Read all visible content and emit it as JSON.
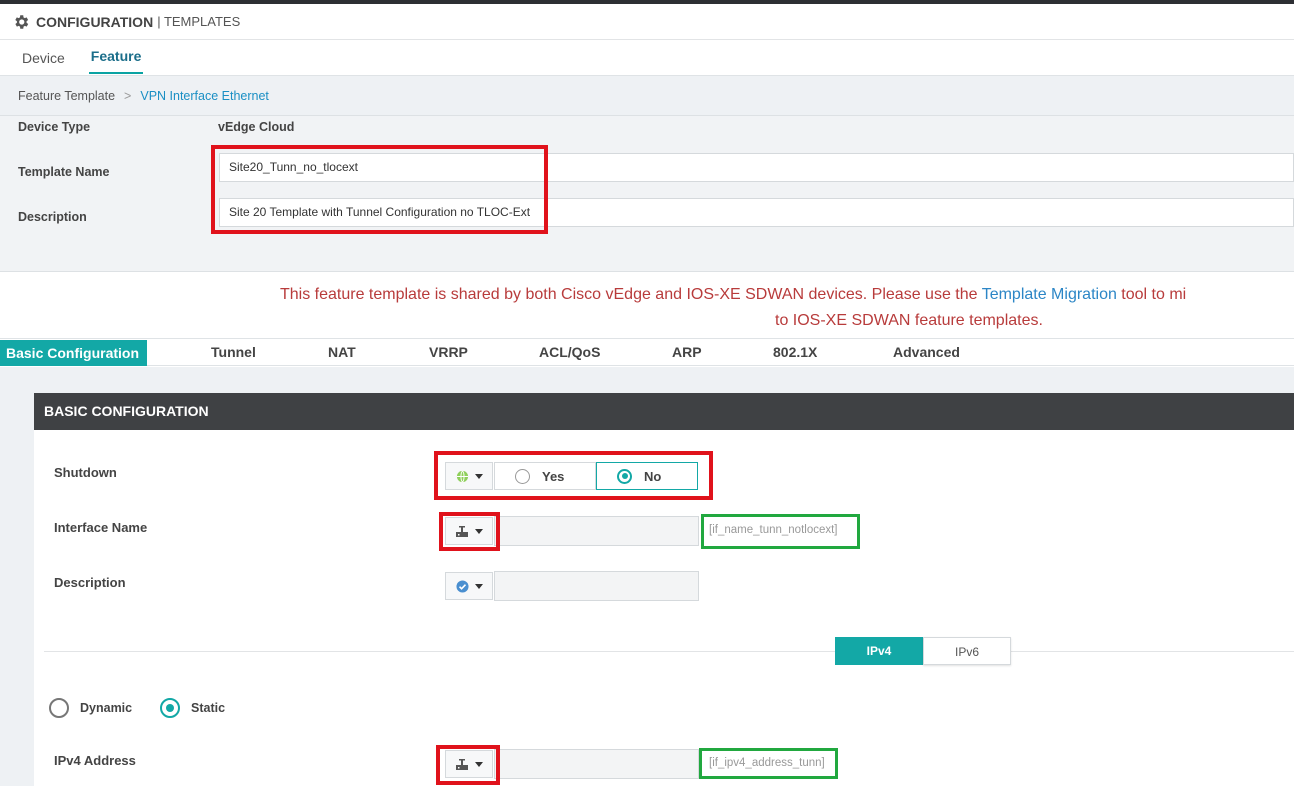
{
  "header": {
    "title": "CONFIGURATION",
    "subtitle": "| TEMPLATES",
    "icon": "gear-icon"
  },
  "tabs": [
    {
      "label": "Device",
      "active": false
    },
    {
      "label": "Feature",
      "active": true
    }
  ],
  "breadcrumb": {
    "root": "Feature Template",
    "separator": ">",
    "current": "VPN Interface Ethernet"
  },
  "meta": {
    "device_type_label": "Device Type",
    "device_type_value": "vEdge Cloud",
    "template_name_label": "Template Name",
    "template_name_value": "Site20_Tunn_no_tlocext",
    "description_label": "Description",
    "description_value": "Site 20 Template with Tunnel Configuration no TLOC-Ext"
  },
  "notice": {
    "part1": "This feature template is shared by both Cisco vEdge and IOS-XE SDWAN devices. Please use the ",
    "link": "Template Migration",
    "part2": " tool to mi",
    "line2": "to IOS-XE SDWAN feature templates."
  },
  "section_tabs": [
    {
      "label": "Basic Configuration",
      "active": true
    },
    {
      "label": "Tunnel"
    },
    {
      "label": "NAT"
    },
    {
      "label": "VRRP"
    },
    {
      "label": "ACL/QoS"
    },
    {
      "label": "ARP"
    },
    {
      "label": "802.1X"
    },
    {
      "label": "Advanced"
    }
  ],
  "basic": {
    "heading": "BASIC CONFIGURATION",
    "shutdown": {
      "label": "Shutdown",
      "scope_icon": "globe-icon",
      "yes_label": "Yes",
      "no_label": "No",
      "selected": "No"
    },
    "interface_name": {
      "label": "Interface Name",
      "scope_icon": "device-specific-icon",
      "value": "",
      "variable": "[if_name_tunn_notlocext]"
    },
    "description": {
      "label": "Description",
      "scope_icon": "default-check-icon",
      "value": ""
    },
    "ip_toggle": {
      "ipv4": "IPv4",
      "ipv6": "IPv6",
      "selected": "IPv4"
    },
    "address_mode": {
      "dynamic_label": "Dynamic",
      "static_label": "Static",
      "selected": "Static"
    },
    "ipv4_address": {
      "label": "IPv4 Address",
      "scope_icon": "device-specific-icon",
      "value": "",
      "variable": "[if_ipv4_address_tunn]"
    }
  },
  "colors": {
    "accent": "#13a8a6",
    "highlight_red": "#e0121b",
    "highlight_green": "#21a83f",
    "notice_text": "#b83b3b",
    "link": "#2c86c6",
    "dark_header": "#3f4144"
  }
}
